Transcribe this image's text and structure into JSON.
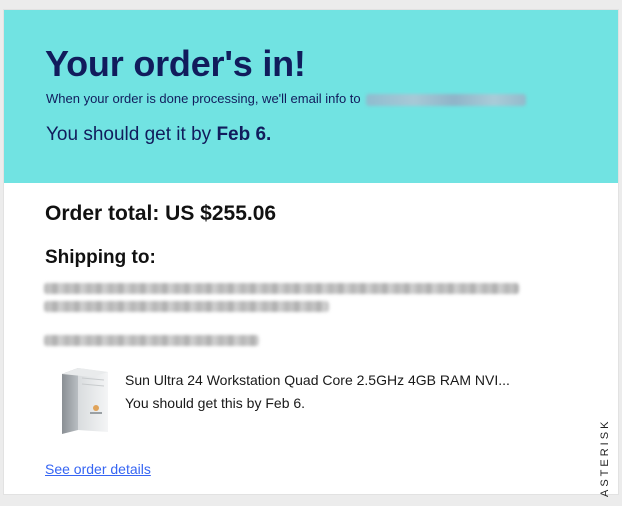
{
  "hero": {
    "title": "Your order's in!",
    "email_text": "When your order is done processing, we'll email info to",
    "eta_prefix": "You should get it by ",
    "eta_date": "Feb 6."
  },
  "order": {
    "total_label": "Order total: US $255.06",
    "shipping_heading": "Shipping to:"
  },
  "item": {
    "title": "Sun Ultra 24 Workstation Quad Core 2.5GHz 4GB RAM NVI...",
    "eta": "You should get this by Feb 6.",
    "thumbnail_icon": "workstation-tower-icon"
  },
  "links": {
    "see_order_details": "See order details"
  },
  "watermark": {
    "text": "ASTERISK"
  },
  "colors": {
    "hero_background": "#71e3e2",
    "hero_text": "#111c5c",
    "link": "#3665f3"
  }
}
